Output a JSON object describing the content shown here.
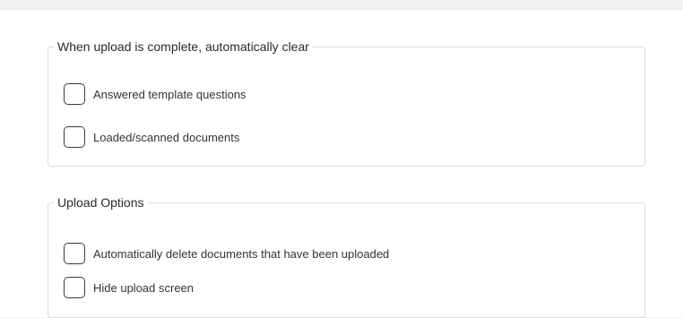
{
  "clear_section": {
    "legend": "When upload is complete, automatically clear",
    "options": [
      {
        "label": "Answered template questions",
        "checked": false
      },
      {
        "label": "Loaded/scanned documents",
        "checked": false
      }
    ]
  },
  "upload_section": {
    "legend": "Upload Options",
    "options": [
      {
        "label": "Automatically delete documents that have been uploaded",
        "checked": false
      },
      {
        "label": "Hide upload screen",
        "checked": false
      }
    ]
  }
}
